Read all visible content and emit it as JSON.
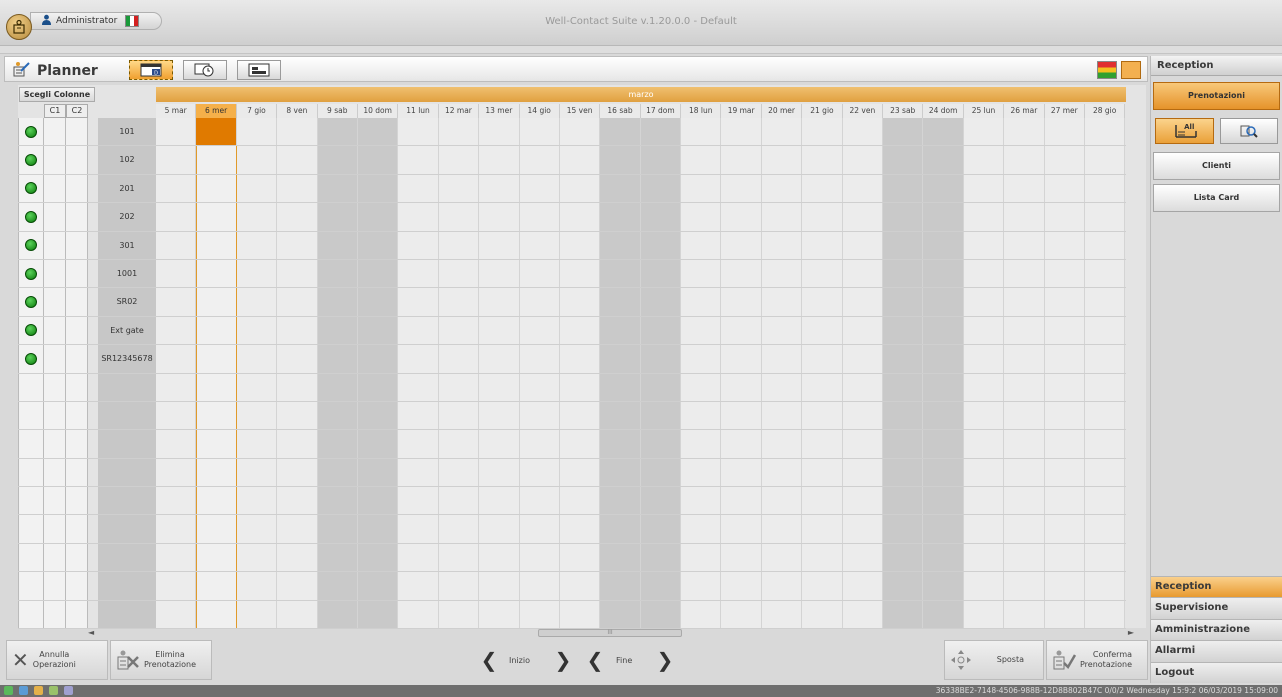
{
  "window": {
    "title": "Well-Contact Suite v.1.20.0.0 - Default"
  },
  "user": {
    "name": "Administrator"
  },
  "planner": {
    "title": "Planner",
    "toolbar_icons": [
      "day-view-icon",
      "time-view-icon",
      "card-view-icon"
    ]
  },
  "grid": {
    "choose_columns": "Scegli Colonne",
    "col1": "C1",
    "col2": "C2",
    "month": "marzo",
    "days": [
      "5 mar",
      "6 mer",
      "7 gio",
      "8 ven",
      "9 sab",
      "10 dom",
      "11 lun",
      "12 mar",
      "13 mer",
      "14 gio",
      "15 ven",
      "16 sab",
      "17 dom",
      "18 lun",
      "19 mar",
      "20 mer",
      "21 gio",
      "22 ven",
      "23 sab",
      "24 dom",
      "25 lun",
      "26 mar",
      "27 mer",
      "28 gio"
    ],
    "selected_day": "6 mer",
    "rooms": [
      "101",
      "102",
      "201",
      "202",
      "301",
      "1001",
      "SR02",
      "Ext gate",
      "SR12345678"
    ],
    "empty_rows": 9
  },
  "actions": {
    "annulla": "Annulla\nOperazioni",
    "elimina": "Elimina\nPrenotazione",
    "inizio": "Inizio",
    "fine": "Fine",
    "sposta": "Sposta",
    "conferma": "Conferma\nPrenotazione"
  },
  "sidebar": {
    "header": "Reception",
    "prenotazioni": "Prenotazioni",
    "filter_all": "All",
    "clienti": "Clienti",
    "lista_card": "Lista Card",
    "menu": [
      "Reception",
      "Supervisione",
      "Amministrazione",
      "Allarmi",
      "Logout"
    ],
    "active_menu": "Reception"
  },
  "status": {
    "text": "36338BE2-7148-4506-988B-12D8B802B47C 0/0/2 Wednesday 15:9:2 06/03/2019 15:09:00"
  },
  "colors": {
    "accent": "#e8962e",
    "booking": "#e07a00",
    "free": "#12a012"
  }
}
